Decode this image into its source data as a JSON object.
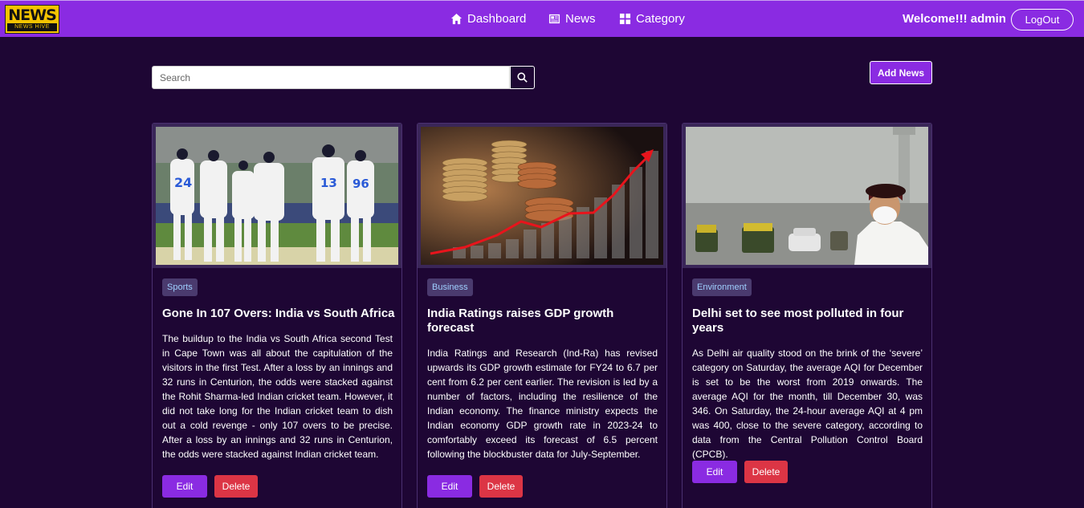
{
  "brand": {
    "logo_main": "NEWS",
    "logo_sub": "NEWS HIVE"
  },
  "nav": {
    "items": [
      {
        "label": "Dashboard",
        "icon": "home-icon"
      },
      {
        "label": "News",
        "icon": "newspaper-icon"
      },
      {
        "label": "Category",
        "icon": "grid-icon"
      }
    ],
    "welcome": "Welcome!!! admin",
    "logout_label": "LogOut"
  },
  "search": {
    "placeholder": "Search",
    "value": ""
  },
  "add_news_label": "Add News",
  "cards": [
    {
      "category": "Sports",
      "title": "Gone In 107 Overs: India vs South Africa",
      "description": "The buildup to the India vs South Africa second Test in Cape Town was all about the capitulation of the visitors in the first Test. After a loss by an innings and 32 runs in Centurion, the odds were stacked against the Rohit Sharma-led Indian cricket team. However, it did not take long for the Indian cricket team to dish out a cold revenge - only 107 overs to be precise. After a loss by an innings and 32 runs in Centurion, the odds were stacked against Indian cricket team.",
      "edit_label": "Edit",
      "delete_label": "Delete",
      "image": "cricket-team-photo",
      "jersey_numbers": [
        "24",
        "13",
        "96"
      ]
    },
    {
      "category": "Business",
      "title": "India Ratings raises GDP growth forecast",
      "description": "India Ratings and Research (Ind-Ra) has revised upwards its GDP growth estimate for FY24 to 6.7 per cent from 6.2 per cent earlier. The revision is led by a number of factors, including the resilience of the Indian economy. The finance ministry expects the Indian economy GDP growth rate in 2023-24 to comfortably exceed its forecast of 6.5 percent following the blockbuster data for July-September.",
      "edit_label": "Edit",
      "delete_label": "Delete",
      "image": "coins-growth-chart-photo"
    },
    {
      "category": "Environment",
      "title": "Delhi set to see most polluted in four years",
      "description": "As Delhi air quality stood on the brink of the ‘severe’ category on Saturday, the average AQI for December is set to be the worst from 2019 onwards. The average AQI for the month, till December 30, was 346. On Saturday, the 24-hour average AQI at 4 pm was 400, close to the severe category, according to data from the Central Pollution Control Board (CPCB).",
      "edit_label": "Edit",
      "delete_label": "Delete",
      "image": "delhi-smog-photo"
    }
  ],
  "colors": {
    "navbar": "#8a2be2",
    "background": "#1e0634",
    "edit": "#8a2be2",
    "delete": "#dc3545",
    "badge_text": "#9fd0ff"
  }
}
